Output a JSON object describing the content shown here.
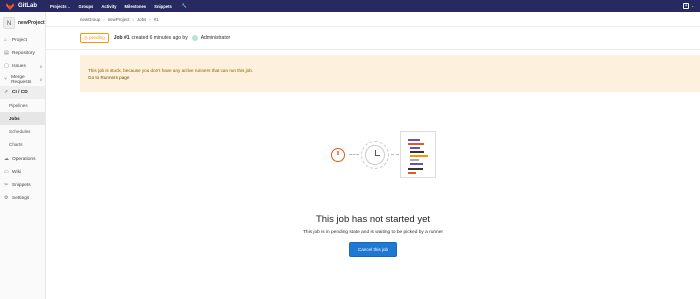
{
  "topbar": {
    "brand": "GitLab",
    "nav": [
      {
        "label": "Projects",
        "has_caret": true
      },
      {
        "label": "Groups"
      },
      {
        "label": "Activity"
      },
      {
        "label": "Milestones"
      },
      {
        "label": "Snippets"
      }
    ],
    "plus": "+",
    "caret": "⌄"
  },
  "sidebar": {
    "project_initial": "N",
    "project_name": "newProject",
    "items": [
      {
        "label": "Project",
        "icon": "home-icon"
      },
      {
        "label": "Repository",
        "icon": "doc-icon"
      },
      {
        "label": "Issues",
        "icon": "issues-icon",
        "count": "0"
      },
      {
        "label": "Merge Requests",
        "icon": "merge-icon",
        "count": "0"
      },
      {
        "label": "CI / CD",
        "icon": "rocket-icon",
        "active": true
      },
      {
        "label": "Operations",
        "icon": "cloud-icon"
      },
      {
        "label": "Wiki",
        "icon": "book-icon"
      },
      {
        "label": "Snippets",
        "icon": "scissors-icon"
      },
      {
        "label": "Settings",
        "icon": "gear-icon"
      }
    ],
    "ci_sub": [
      "Pipelines",
      "Jobs",
      "Schedules",
      "Charts"
    ],
    "ci_active_sub": "Jobs"
  },
  "breadcrumb": [
    "newGroup",
    "newProject",
    "Jobs",
    "#1"
  ],
  "job": {
    "status": "pending",
    "id_label": "Job #1",
    "created_text": "created 6 minutes ago by",
    "user": "Administrator"
  },
  "alert": {
    "message": "This job is stuck, because you don't have any active runners that can run this job.",
    "link": "Go to Runners page"
  },
  "empty_state": {
    "title": "This job has not started yet",
    "description": "This job is in pending state and is waiting to be picked by a runner",
    "button": "Cancel this job",
    "pending_glyph": "II"
  },
  "colors": {
    "topbar": "#292961",
    "pending": "#fc9403",
    "primary_button": "#1f78d1",
    "alert_bg": "#fdf1dd"
  }
}
